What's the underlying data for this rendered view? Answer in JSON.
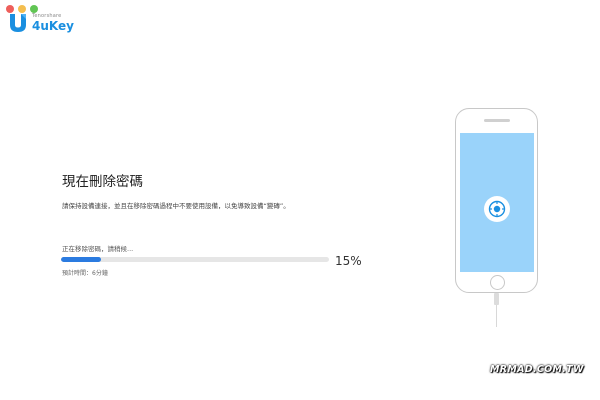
{
  "window": {
    "controls": [
      "close",
      "minimize",
      "maximize"
    ]
  },
  "brand": {
    "company": "Tenorshare",
    "product": "4uKey",
    "logo_color": "#1a8fe0"
  },
  "main": {
    "title": "現在刪除密碼",
    "description": "請保持設備連接，並且在移除密碼過程中不要使用設備，以免導致設備“變磚”。",
    "status": "正在移除密碼，請稍候...",
    "progress": {
      "percent_label": "15%",
      "fraction": 0.15,
      "bar_color": "#2b7be0"
    },
    "eta": "預計時間：6分鐘"
  },
  "device": {
    "type": "iphone",
    "screen_color": "#9ad3fa",
    "icon": "lock-icon"
  },
  "watermark": {
    "text": "MRMAD.COM.TW"
  }
}
